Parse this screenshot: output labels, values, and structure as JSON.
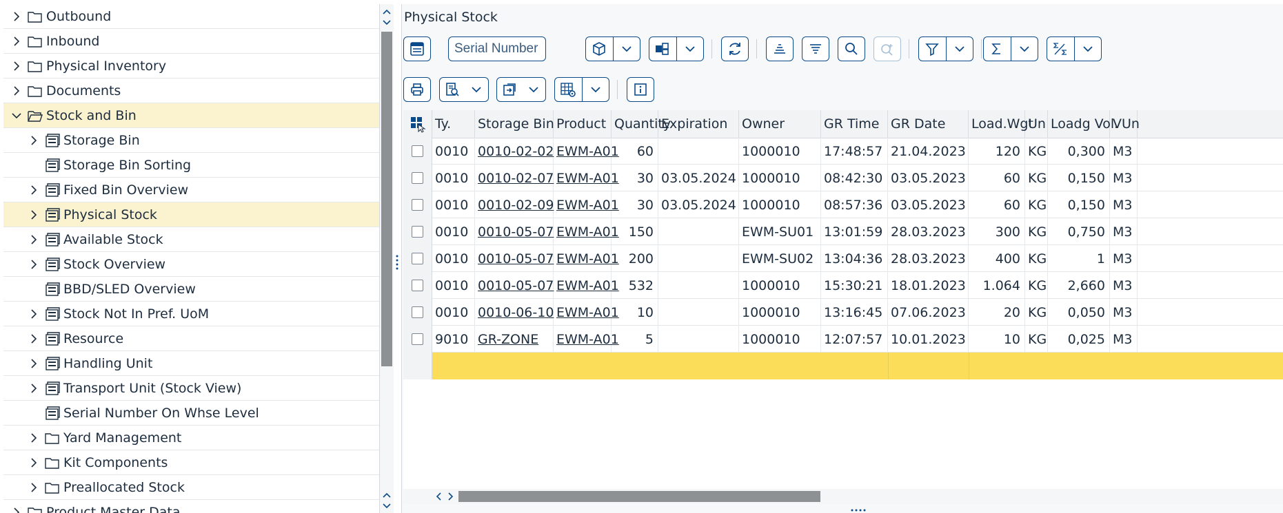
{
  "tree": {
    "items": [
      {
        "label": "Outbound",
        "icon": "folder-icon",
        "level": 0,
        "expand": "right"
      },
      {
        "label": "Inbound",
        "icon": "folder-icon",
        "level": 0,
        "expand": "right"
      },
      {
        "label": "Physical Inventory",
        "icon": "folder-icon",
        "level": 0,
        "expand": "right"
      },
      {
        "label": "Documents",
        "icon": "folder-icon",
        "level": 0,
        "expand": "right"
      },
      {
        "label": "Stock and Bin",
        "icon": "folder-open-icon",
        "level": 0,
        "expand": "down",
        "selected": true
      },
      {
        "label": "Storage Bin",
        "icon": "report-icon",
        "level": 1,
        "expand": "right"
      },
      {
        "label": "Storage Bin Sorting",
        "icon": "report-icon",
        "level": 1,
        "expand": ""
      },
      {
        "label": "Fixed Bin Overview",
        "icon": "report-icon",
        "level": 1,
        "expand": "right"
      },
      {
        "label": "Physical Stock",
        "icon": "report-icon",
        "level": 1,
        "expand": "right",
        "selected": true
      },
      {
        "label": "Available Stock",
        "icon": "report-icon",
        "level": 1,
        "expand": "right"
      },
      {
        "label": "Stock Overview",
        "icon": "report-icon",
        "level": 1,
        "expand": "right"
      },
      {
        "label": "BBD/SLED Overview",
        "icon": "report-icon",
        "level": 1,
        "expand": ""
      },
      {
        "label": "Stock Not In Pref. UoM",
        "icon": "report-icon",
        "level": 1,
        "expand": "right"
      },
      {
        "label": "Resource",
        "icon": "report-icon",
        "level": 1,
        "expand": "right"
      },
      {
        "label": "Handling Unit",
        "icon": "report-icon",
        "level": 1,
        "expand": "right"
      },
      {
        "label": "Transport Unit  (Stock View)",
        "icon": "report-icon",
        "level": 1,
        "expand": "right"
      },
      {
        "label": "Serial Number On Whse Level",
        "icon": "report-icon",
        "level": 1,
        "expand": ""
      },
      {
        "label": "Yard Management",
        "icon": "folder-icon",
        "level": 1,
        "expand": "right"
      },
      {
        "label": "Kit Components",
        "icon": "folder-icon",
        "level": 1,
        "expand": "right"
      },
      {
        "label": "Preallocated Stock",
        "icon": "folder-icon",
        "level": 1,
        "expand": "right"
      },
      {
        "label": "Product Master Data",
        "icon": "folder-icon",
        "level": 0,
        "expand": "right"
      }
    ]
  },
  "panel": {
    "title": "Physical Stock",
    "search_value": "Serial Number"
  },
  "grid": {
    "columns": [
      "Ty.",
      "Storage Bin",
      "Product",
      "Quantity",
      "Expiration",
      "Owner",
      "GR Time",
      "GR Date",
      "Load.Wgt",
      "Un",
      "Loadg Vol.",
      "VUn"
    ],
    "rows": [
      [
        "0010",
        "0010-02-02",
        "EWM-A01",
        "60",
        "",
        "1000010",
        "17:48:57",
        "21.04.2023",
        "120",
        "KG",
        "0,300",
        "M3"
      ],
      [
        "0010",
        "0010-02-07",
        "EWM-A01",
        "30",
        "03.05.2024",
        "1000010",
        "08:42:30",
        "03.05.2023",
        "60",
        "KG",
        "0,150",
        "M3"
      ],
      [
        "0010",
        "0010-02-09",
        "EWM-A01",
        "30",
        "03.05.2024",
        "1000010",
        "08:57:36",
        "03.05.2023",
        "60",
        "KG",
        "0,150",
        "M3"
      ],
      [
        "0010",
        "0010-05-07",
        "EWM-A01",
        "150",
        "",
        "EWM-SU01",
        "13:01:59",
        "28.03.2023",
        "300",
        "KG",
        "0,750",
        "M3"
      ],
      [
        "0010",
        "0010-05-07",
        "EWM-A01",
        "200",
        "",
        "EWM-SU02",
        "13:04:36",
        "28.03.2023",
        "400",
        "KG",
        "1",
        "M3"
      ],
      [
        "0010",
        "0010-05-07",
        "EWM-A01",
        "532",
        "",
        "1000010",
        "15:30:21",
        "18.01.2023",
        "1.064",
        "KG",
        "2,660",
        "M3"
      ],
      [
        "0010",
        "0010-06-10",
        "EWM-A01",
        "10",
        "",
        "1000010",
        "13:16:45",
        "07.06.2023",
        "20",
        "KG",
        "0,050",
        "M3"
      ],
      [
        "9010",
        "GR-ZONE",
        "EWM-A01",
        "5",
        "",
        "1000010",
        "12:07:57",
        "10.01.2023",
        "10",
        "KG",
        "0,025",
        "M3"
      ]
    ]
  },
  "colors": {
    "accent": "#0a4a8a",
    "selected_row": "#fbf3d0",
    "totals_row": "#fbdd5a"
  }
}
